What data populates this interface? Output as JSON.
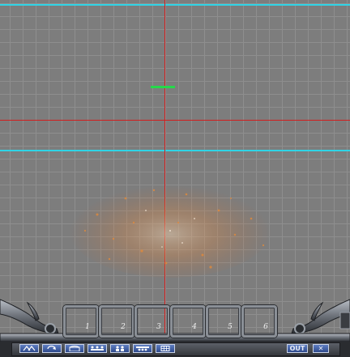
{
  "scene": {
    "background_color": "#7d7d7d",
    "grid_color": "#8e8e8e",
    "guide_colors": {
      "cyan": "#2fd4e6",
      "red": "#d21d1d",
      "green": "#26d94a"
    }
  },
  "skill_slots": [
    {
      "number": "1"
    },
    {
      "number": "2"
    },
    {
      "number": "3"
    },
    {
      "number": "4"
    },
    {
      "number": "5"
    },
    {
      "number": "6"
    }
  ],
  "toolbar": {
    "buttons": [
      {
        "icon": "up-arrows-icon"
      },
      {
        "icon": "rotate-icon"
      },
      {
        "icon": "chest-icon"
      },
      {
        "icon": "party-icon"
      },
      {
        "icon": "users-icon"
      },
      {
        "icon": "group-icon"
      },
      {
        "icon": "grid-icon"
      }
    ],
    "out_label": "OUT",
    "close_label": "✕"
  }
}
